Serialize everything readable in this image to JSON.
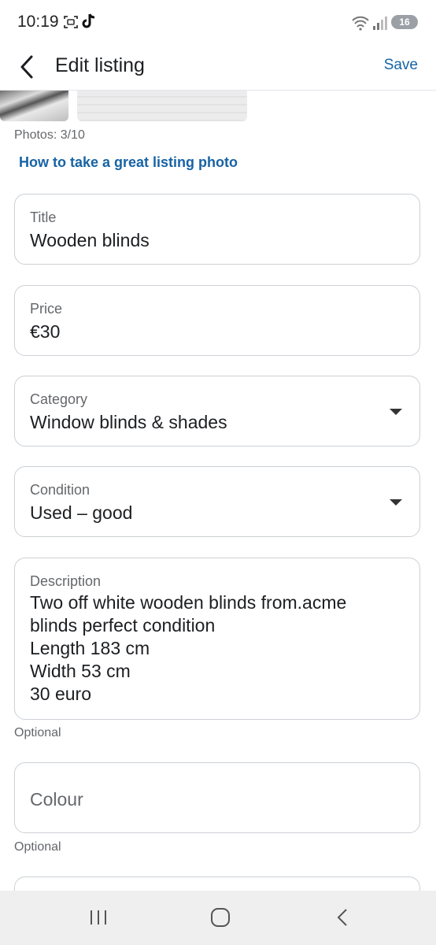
{
  "status_bar": {
    "time": "10:19",
    "battery": "16",
    "icons": [
      "screenshot-icon",
      "tiktok-icon",
      "wifi-icon",
      "signal-icon"
    ]
  },
  "header": {
    "title": "Edit listing",
    "save_label": "Save"
  },
  "photos": {
    "count_text": "Photos: 3/10",
    "tip_link": "How to take a great listing photo"
  },
  "fields": {
    "title": {
      "label": "Title",
      "value": "Wooden blinds"
    },
    "price": {
      "label": "Price",
      "value": "€30"
    },
    "category": {
      "label": "Category",
      "value": "Window blinds & shades"
    },
    "condition": {
      "label": "Condition",
      "value": "Used – good"
    },
    "description": {
      "label": "Description",
      "lines": [
        "Two off white wooden blinds from.acme",
        "blinds perfect condition",
        "Length 183 cm",
        "Width 53 cm",
        "30 euro"
      ],
      "helper": "Optional"
    },
    "colour": {
      "placeholder": "Colour",
      "helper": "Optional"
    }
  },
  "nav_bar": {
    "icons": [
      "recent-apps-icon",
      "home-icon",
      "back-icon"
    ]
  }
}
